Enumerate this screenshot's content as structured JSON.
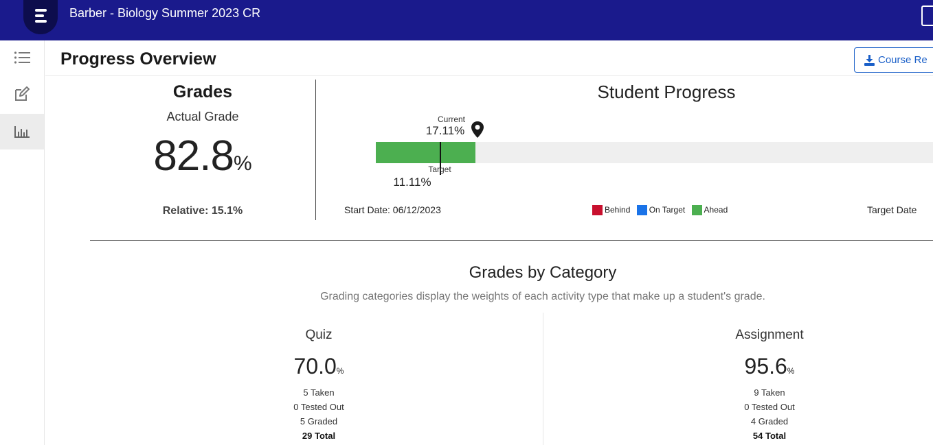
{
  "header": {
    "course_title": "Barber - Biology Summer 2023 CR"
  },
  "sidebar": {
    "items": [
      {
        "icon": "list-icon"
      },
      {
        "icon": "edit-icon"
      },
      {
        "icon": "bar-chart-icon",
        "active": true
      }
    ]
  },
  "page": {
    "title": "Progress Overview",
    "report_button_label": "Course Re"
  },
  "grades": {
    "heading": "Grades",
    "actual_label": "Actual Grade",
    "actual_value": "82.8",
    "actual_unit": "%",
    "relative": "Relative: 15.1%"
  },
  "student_progress": {
    "title": "Student Progress",
    "current_label": "Current",
    "current_value": "17.11%",
    "current_fraction": 0.1711,
    "target_label": "Target",
    "target_value": "11.11%",
    "target_fraction": 0.1111,
    "start_date": "Start Date: 06/12/2023",
    "target_date": "Target Date",
    "legend": [
      {
        "label": "Behind",
        "color": "#c8102e"
      },
      {
        "label": "On Target",
        "color": "#1a73e8"
      },
      {
        "label": "Ahead",
        "color": "#4caf50"
      }
    ],
    "fill_color": "#4caf50"
  },
  "categories": {
    "title": "Grades by Category",
    "subtitle": "Grading categories display the weights of each activity type that make up a student's grade.",
    "items": [
      {
        "name": "Quiz",
        "value": "70.0",
        "unit": "%",
        "taken": "5 Taken",
        "tested_out": "0 Tested Out",
        "graded": "5 Graded",
        "total": "29 Total"
      },
      {
        "name": "Assignment",
        "value": "95.6",
        "unit": "%",
        "taken": "9 Taken",
        "tested_out": "0 Tested Out",
        "graded": "4 Graded",
        "total": "54 Total"
      }
    ]
  }
}
